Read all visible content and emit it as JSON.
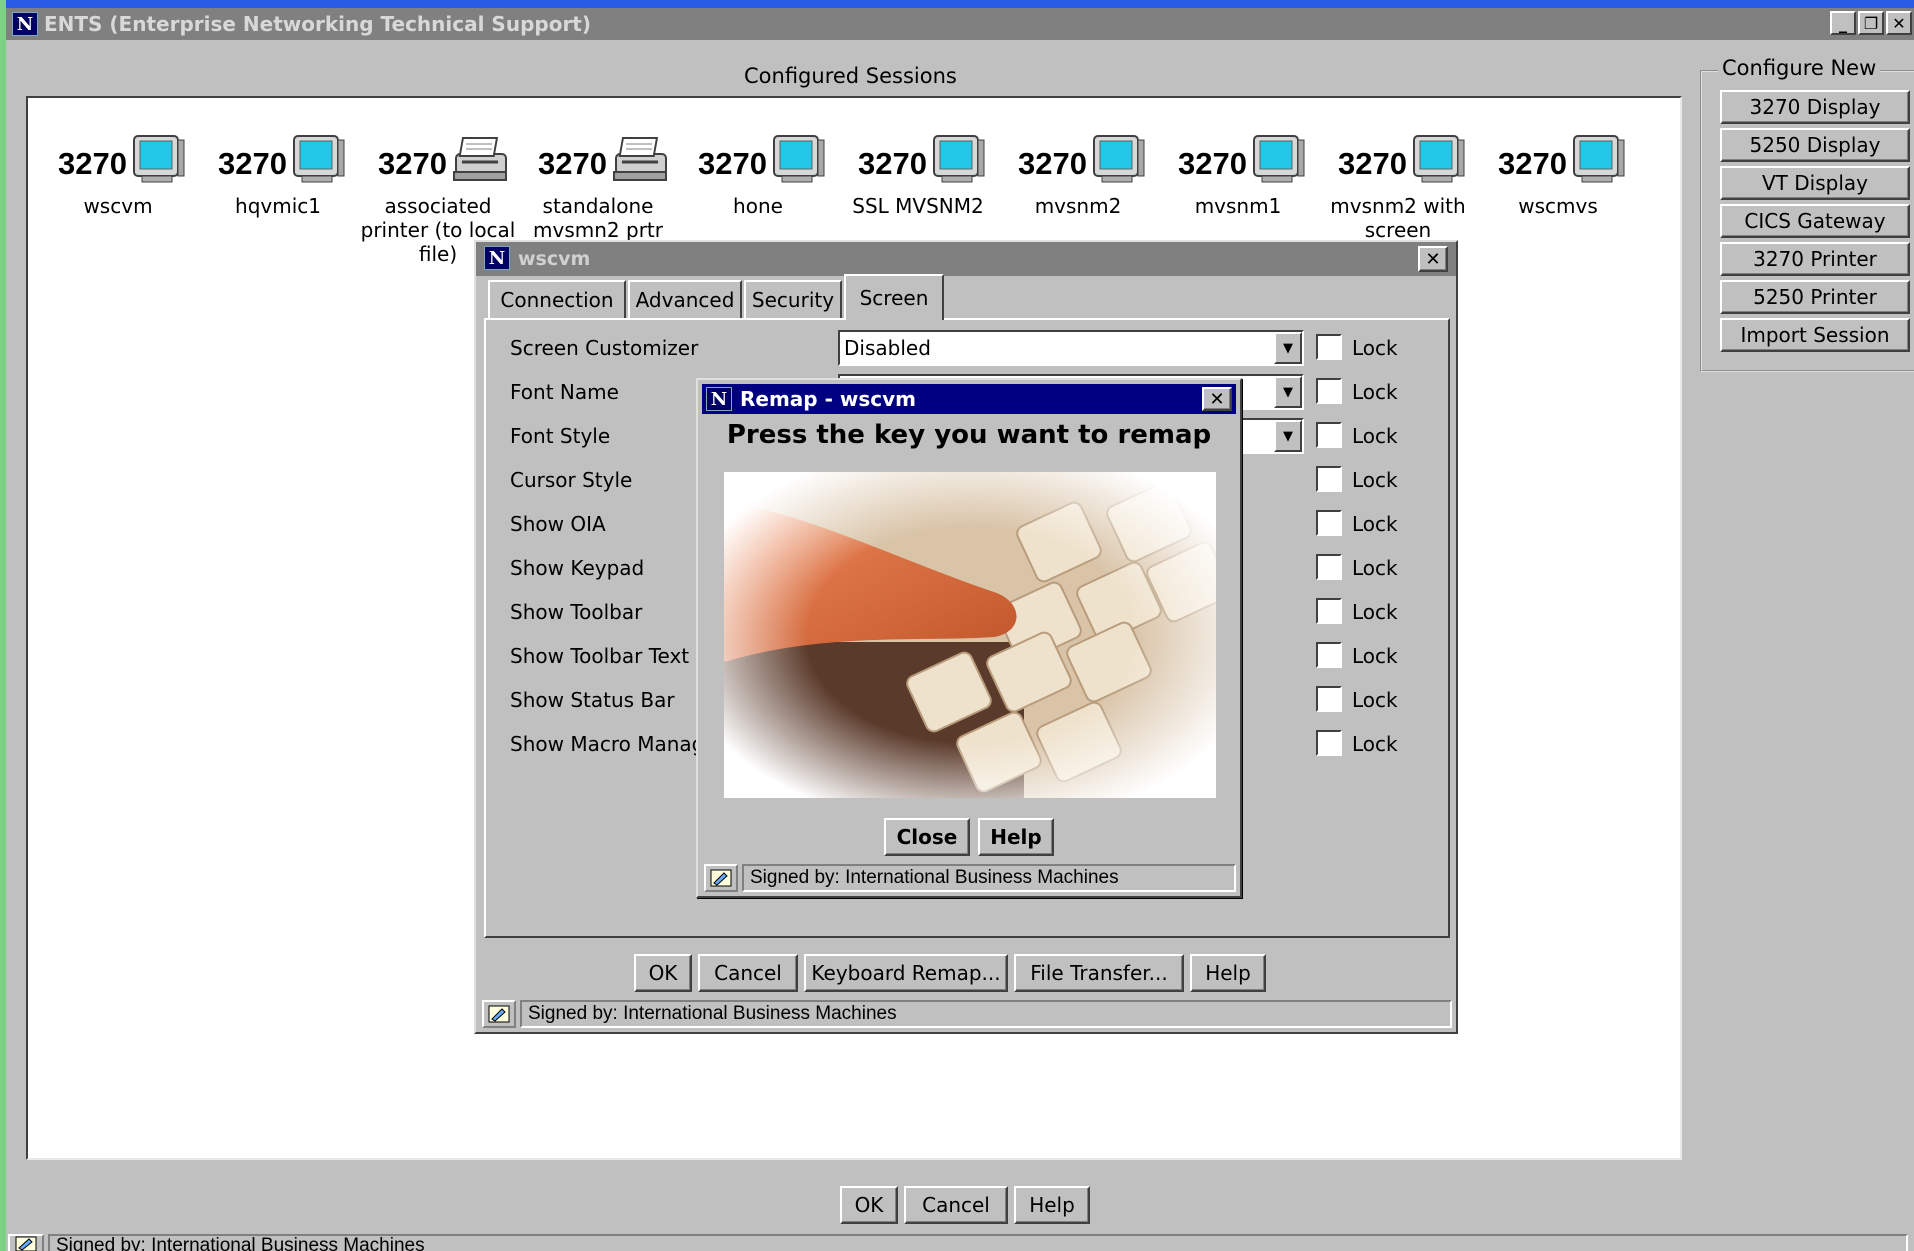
{
  "window": {
    "title": "ENTS (Enterprise Networking Technical Support)",
    "controls": [
      "_",
      "❐",
      "✕"
    ]
  },
  "sessions": {
    "heading": "Configured Sessions",
    "items": [
      {
        "type": "3270",
        "icon": "monitor-icon",
        "label": "wscvm"
      },
      {
        "type": "3270",
        "icon": "monitor-icon",
        "label": "hqvmic1"
      },
      {
        "type": "3270",
        "icon": "printer-icon",
        "label": "associated printer (to local file)"
      },
      {
        "type": "3270",
        "icon": "printer-icon",
        "label": "standalone mvsmn2 prtr"
      },
      {
        "type": "3270",
        "icon": "monitor-icon",
        "label": "hone"
      },
      {
        "type": "3270",
        "icon": "monitor-icon",
        "label": "SSL MVSNM2"
      },
      {
        "type": "3270",
        "icon": "monitor-icon",
        "label": "mvsnm2"
      },
      {
        "type": "3270",
        "icon": "monitor-icon",
        "label": "mvsnm1"
      },
      {
        "type": "3270",
        "icon": "monitor-icon",
        "label": "mvsnm2 with screen"
      },
      {
        "type": "3270",
        "icon": "monitor-icon",
        "label": "wscmvs"
      }
    ]
  },
  "configure_new": {
    "legend": "Configure New",
    "buttons": [
      "3270 Display",
      "5250 Display",
      "VT Display",
      "CICS Gateway",
      "3270 Printer",
      "5250 Printer",
      "Import Session"
    ]
  },
  "main_buttons": {
    "ok": "OK",
    "cancel": "Cancel",
    "help": "Help"
  },
  "main_status": "Signed by: International Business Machines",
  "session_dialog": {
    "title": "wscvm",
    "tabs": [
      "Connection",
      "Advanced",
      "Security",
      "Screen"
    ],
    "active_tab": "Screen",
    "rows": [
      {
        "label": "Screen Customizer",
        "value": "Disabled"
      },
      {
        "label": "Font Name"
      },
      {
        "label": "Font Style"
      },
      {
        "label": "Cursor Style"
      },
      {
        "label": "Show OIA"
      },
      {
        "label": "Show Keypad"
      },
      {
        "label": "Show Toolbar"
      },
      {
        "label": "Show Toolbar Text"
      },
      {
        "label": "Show Status Bar"
      },
      {
        "label": "Show Macro Manag"
      }
    ],
    "lock_label": "Lock",
    "buttons": {
      "ok": "OK",
      "cancel": "Cancel",
      "keyboard_remap": "Keyboard Remap...",
      "file_transfer": "File Transfer...",
      "help": "Help"
    },
    "status": "Signed by: International Business Machines"
  },
  "remap_dialog": {
    "title": "Remap - wscvm",
    "heading": "Press the key you want to remap",
    "image": "keyboard-photo",
    "buttons": {
      "close": "Close",
      "help": "Help"
    },
    "status": "Signed by: International Business Machines"
  }
}
